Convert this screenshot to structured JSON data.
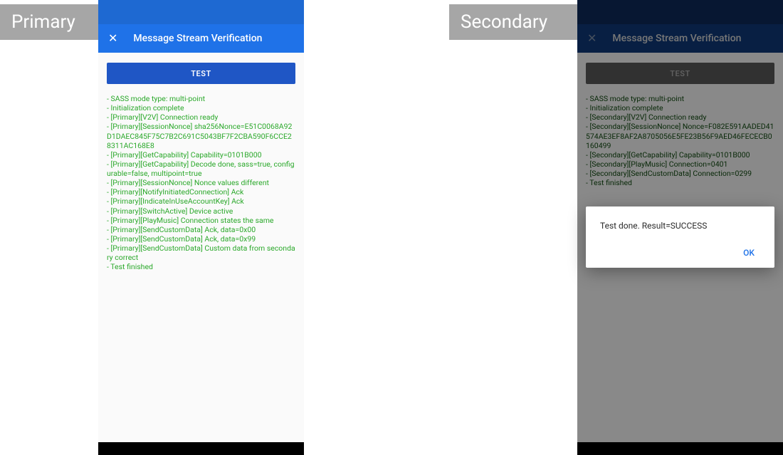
{
  "colors": {
    "statusbar_primary": "#1e69d2",
    "appbar_primary": "#1f72e8",
    "statusbar_secondary": "#0d2b5b",
    "appbar_secondary": "#0f3a7a",
    "test_btn": "#1f56c5",
    "log_text": "#2aa82a",
    "accent": "#1f72e8"
  },
  "labels": {
    "primary_tag": "Primary",
    "secondary_tag": "Secondary",
    "app_title": "Message Stream Verification",
    "close_glyph": "✕",
    "test_btn": "TEST"
  },
  "primary_log": [
    " - SASS mode type: multi-point",
    " - Initialization complete",
    " - [Primary][V2V] Connection ready",
    " - [Primary][SessionNonce] sha256Nonce=E51C0068A92D1DAEC845F75C7B2C691C5043BF7F2CBA590F6CCE28311AC168E8",
    " - [Primary][GetCapability] Capability=0101B000",
    " - [Primary][GetCapability] Decode done, sass=true, configurable=false, multipoint=true",
    " - [Primary][SessionNonce] Nonce values different",
    " - [Primary][NotifyInitiatedConnection] Ack",
    " - [Primary][IndicateInUseAccountKey] Ack",
    " - [Primary][SwitchActive] Device active",
    " - [Primary][PlayMusic] Connection states the same",
    " - [Primary][SendCustomData] Ack, data=0x00",
    " - [Primary][SendCustomData] Ack, data=0x99",
    " - [Primary][SendCustomData] Custom data from secondary correct",
    " - Test finished"
  ],
  "secondary_log": [
    " - SASS mode type: multi-point",
    " - Initialization complete",
    " - [Secondary][V2V] Connection ready",
    " - [Secondary][SessionNonce] Nonce=F082E591AADED41574AE3EF8AF2A8705056E5FE23B56F9AED46FECECB0160499",
    " - [Secondary][GetCapability] Capability=0101B000",
    " - [Secondary][PlayMusic] Connection=0401",
    " - [Secondary][SendCustomData] Connection=0299",
    " - Test finished"
  ],
  "dialog": {
    "message": "Test done. Result=SUCCESS",
    "ok": "OK"
  }
}
